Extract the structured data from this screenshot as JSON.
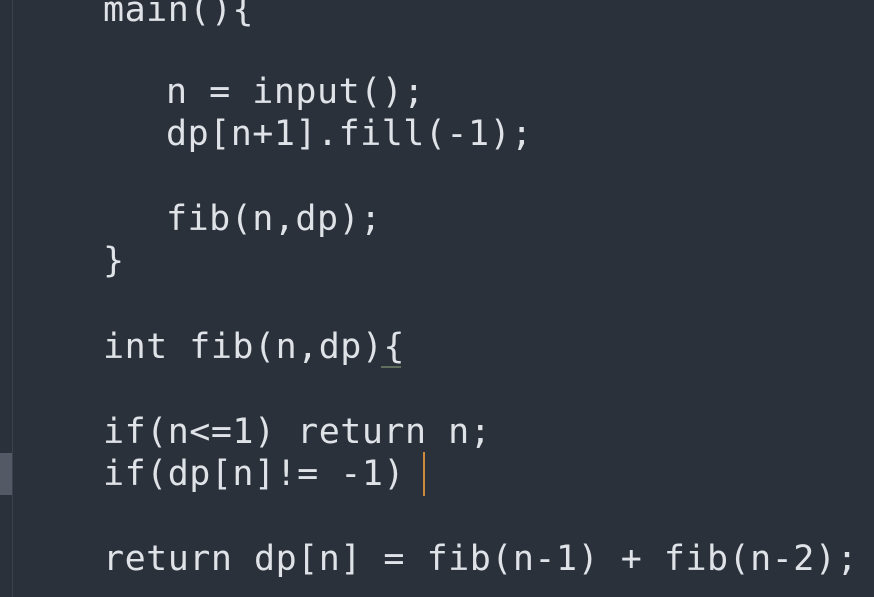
{
  "editor": {
    "lines": [
      "main(){",
      "n = input();",
      "dp[n+1].fill(-1);",
      "fib(n,dp);",
      "}",
      "int fib(n,dp){",
      "if(n<=1) return n;",
      "if(dp[n]!= -1)",
      "return dp[n] = fib(n-1) + fib(n-2);"
    ]
  },
  "colors": {
    "background": "#2b313b",
    "text": "#dfe3e8",
    "caret": "#d08a3f"
  }
}
